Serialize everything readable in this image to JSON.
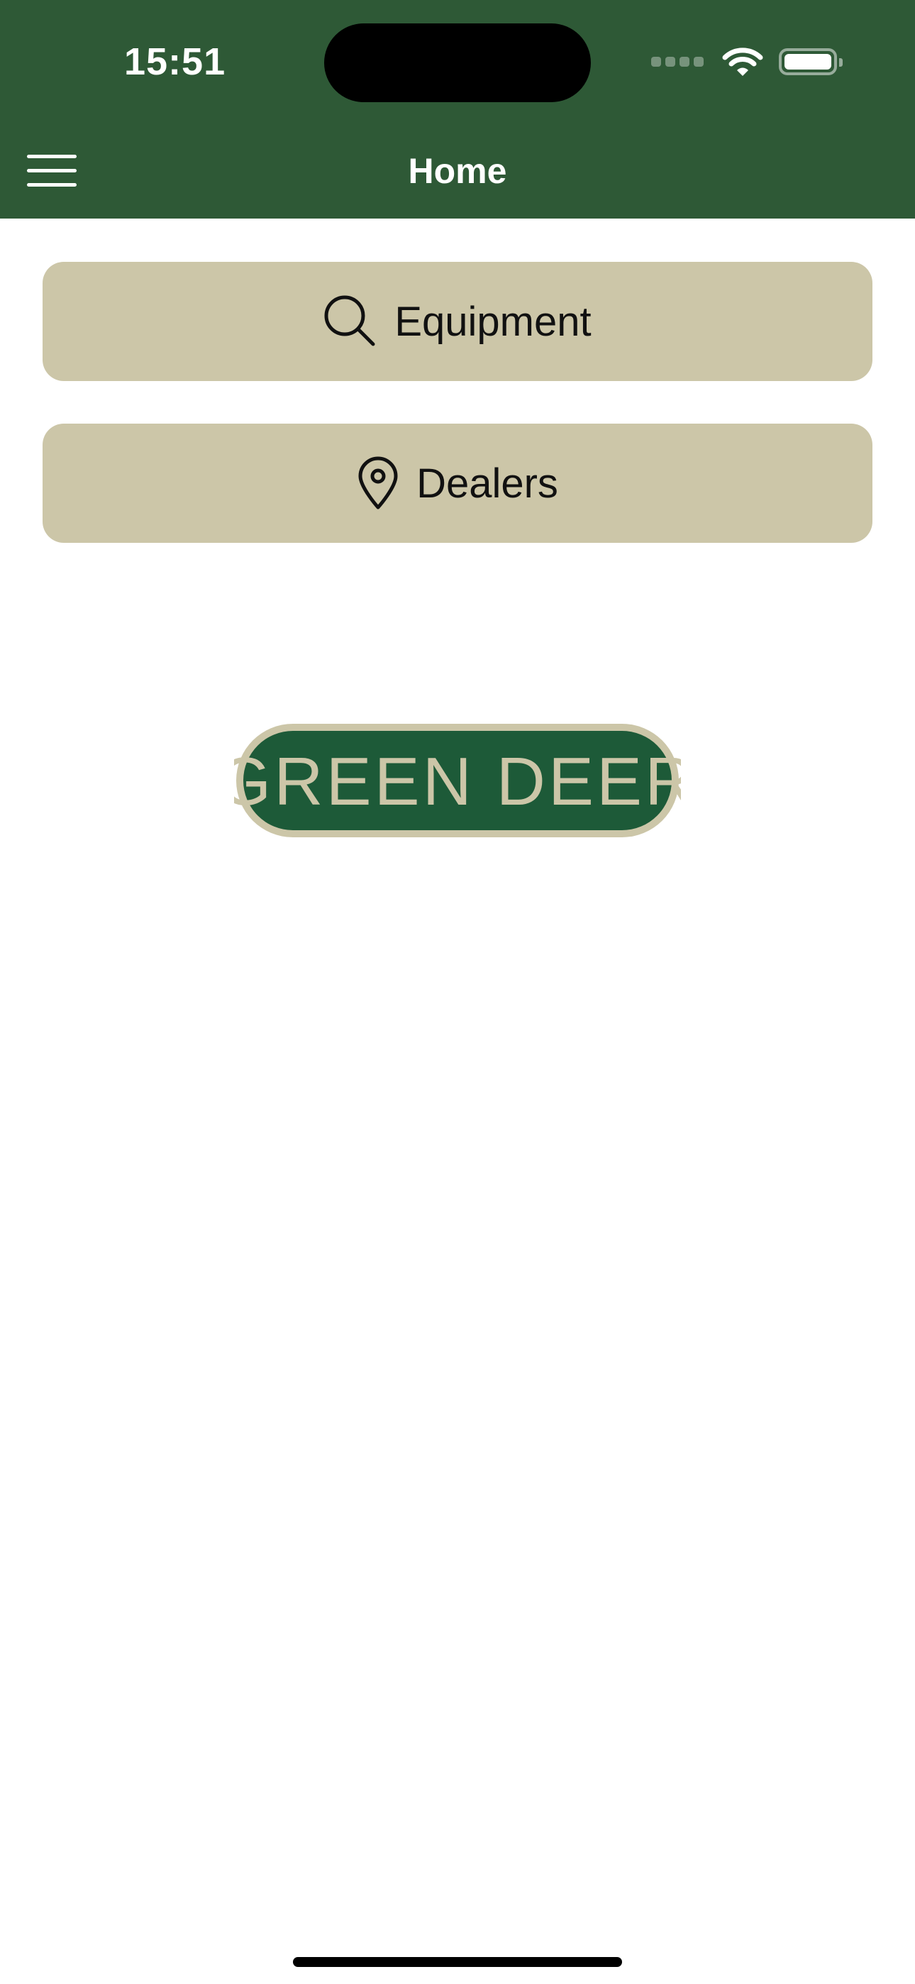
{
  "status_bar": {
    "time": "15:51",
    "icons": [
      "signal-icon",
      "wifi-icon",
      "battery-icon"
    ]
  },
  "nav": {
    "title": "Home",
    "menu_icon": "hamburger-menu-icon"
  },
  "actions": [
    {
      "label": "Equipment",
      "icon": "search-icon"
    },
    {
      "label": "Dealers",
      "icon": "location-pin-icon"
    }
  ],
  "logo": {
    "text": "GREEN DEER"
  },
  "colors": {
    "header": "#2e5936",
    "button": "#ccc6a8",
    "logo_green": "#1d5a38",
    "logo_tan": "#ccc6a8"
  }
}
